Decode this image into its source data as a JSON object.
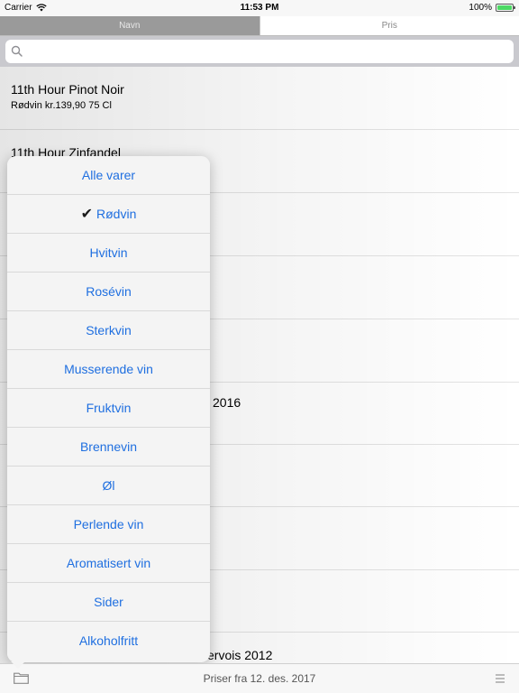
{
  "status_bar": {
    "carrier": "Carrier",
    "time": "11:53 PM",
    "battery": "100%",
    "wifi_icon": "wifi-icon",
    "battery_color": "#4cd964"
  },
  "tabs": [
    {
      "label": "Navn",
      "active": true
    },
    {
      "label": "Pris",
      "active": false
    }
  ],
  "search": {
    "placeholder": ""
  },
  "list": [
    {
      "title": "11th Hour Pinot Noir",
      "subtitle": "Rødvin kr.139,90 75 Cl"
    },
    {
      "title": "11th Hour Zinfandel",
      "subtitle": ""
    },
    {
      "title": "",
      "subtitle": ""
    },
    {
      "title": "",
      "subtitle": ""
    },
    {
      "title": "",
      "subtitle": ""
    },
    {
      "title": "2016",
      "subtitle": ""
    },
    {
      "title": "",
      "subtitle": ""
    },
    {
      "title": "",
      "subtitle": ""
    },
    {
      "title": "",
      "subtitle": ""
    },
    {
      "title": "ervois 2012",
      "subtitle": ""
    }
  ],
  "category_menu": {
    "selected_index": 1,
    "check_glyph": "✔",
    "items": [
      "Alle varer",
      "Rødvin",
      "Hvitvin",
      "Rosévin",
      "Sterkvin",
      "Musserende vin",
      "Fruktvin",
      "Brennevin",
      "Øl",
      "Perlende vin",
      "Aromatisert vin",
      "Sider",
      "Alkoholfritt"
    ]
  },
  "toolbar": {
    "label": "Priser fra 12. des. 2017",
    "left_icon": "folder-icon",
    "right_icon": "menu-icon"
  },
  "colors": {
    "accent": "#1f6fe0",
    "segment_active": "#9a9a9a",
    "search_bar_bg": "#c9c9ce"
  }
}
